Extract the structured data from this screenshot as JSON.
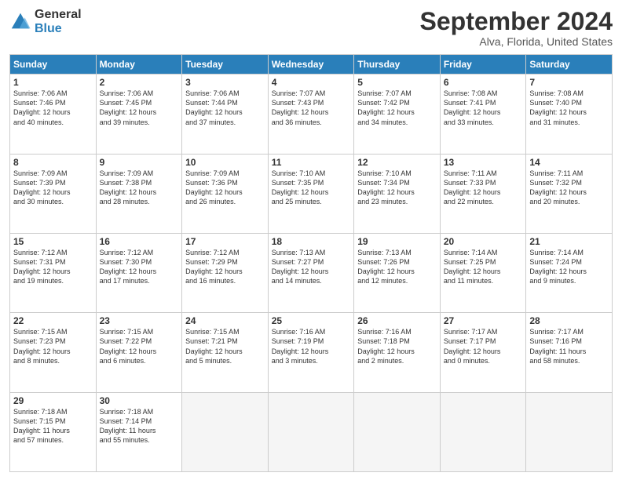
{
  "header": {
    "logo": {
      "general": "General",
      "blue": "Blue"
    },
    "title": "September 2024",
    "location": "Alva, Florida, United States"
  },
  "days_of_week": [
    "Sunday",
    "Monday",
    "Tuesday",
    "Wednesday",
    "Thursday",
    "Friday",
    "Saturday"
  ],
  "weeks": [
    [
      {
        "day": "1",
        "info": "Sunrise: 7:06 AM\nSunset: 7:46 PM\nDaylight: 12 hours\nand 40 minutes."
      },
      {
        "day": "2",
        "info": "Sunrise: 7:06 AM\nSunset: 7:45 PM\nDaylight: 12 hours\nand 39 minutes."
      },
      {
        "day": "3",
        "info": "Sunrise: 7:06 AM\nSunset: 7:44 PM\nDaylight: 12 hours\nand 37 minutes."
      },
      {
        "day": "4",
        "info": "Sunrise: 7:07 AM\nSunset: 7:43 PM\nDaylight: 12 hours\nand 36 minutes."
      },
      {
        "day": "5",
        "info": "Sunrise: 7:07 AM\nSunset: 7:42 PM\nDaylight: 12 hours\nand 34 minutes."
      },
      {
        "day": "6",
        "info": "Sunrise: 7:08 AM\nSunset: 7:41 PM\nDaylight: 12 hours\nand 33 minutes."
      },
      {
        "day": "7",
        "info": "Sunrise: 7:08 AM\nSunset: 7:40 PM\nDaylight: 12 hours\nand 31 minutes."
      }
    ],
    [
      {
        "day": "8",
        "info": "Sunrise: 7:09 AM\nSunset: 7:39 PM\nDaylight: 12 hours\nand 30 minutes."
      },
      {
        "day": "9",
        "info": "Sunrise: 7:09 AM\nSunset: 7:38 PM\nDaylight: 12 hours\nand 28 minutes."
      },
      {
        "day": "10",
        "info": "Sunrise: 7:09 AM\nSunset: 7:36 PM\nDaylight: 12 hours\nand 26 minutes."
      },
      {
        "day": "11",
        "info": "Sunrise: 7:10 AM\nSunset: 7:35 PM\nDaylight: 12 hours\nand 25 minutes."
      },
      {
        "day": "12",
        "info": "Sunrise: 7:10 AM\nSunset: 7:34 PM\nDaylight: 12 hours\nand 23 minutes."
      },
      {
        "day": "13",
        "info": "Sunrise: 7:11 AM\nSunset: 7:33 PM\nDaylight: 12 hours\nand 22 minutes."
      },
      {
        "day": "14",
        "info": "Sunrise: 7:11 AM\nSunset: 7:32 PM\nDaylight: 12 hours\nand 20 minutes."
      }
    ],
    [
      {
        "day": "15",
        "info": "Sunrise: 7:12 AM\nSunset: 7:31 PM\nDaylight: 12 hours\nand 19 minutes."
      },
      {
        "day": "16",
        "info": "Sunrise: 7:12 AM\nSunset: 7:30 PM\nDaylight: 12 hours\nand 17 minutes."
      },
      {
        "day": "17",
        "info": "Sunrise: 7:12 AM\nSunset: 7:29 PM\nDaylight: 12 hours\nand 16 minutes."
      },
      {
        "day": "18",
        "info": "Sunrise: 7:13 AM\nSunset: 7:27 PM\nDaylight: 12 hours\nand 14 minutes."
      },
      {
        "day": "19",
        "info": "Sunrise: 7:13 AM\nSunset: 7:26 PM\nDaylight: 12 hours\nand 12 minutes."
      },
      {
        "day": "20",
        "info": "Sunrise: 7:14 AM\nSunset: 7:25 PM\nDaylight: 12 hours\nand 11 minutes."
      },
      {
        "day": "21",
        "info": "Sunrise: 7:14 AM\nSunset: 7:24 PM\nDaylight: 12 hours\nand 9 minutes."
      }
    ],
    [
      {
        "day": "22",
        "info": "Sunrise: 7:15 AM\nSunset: 7:23 PM\nDaylight: 12 hours\nand 8 minutes."
      },
      {
        "day": "23",
        "info": "Sunrise: 7:15 AM\nSunset: 7:22 PM\nDaylight: 12 hours\nand 6 minutes."
      },
      {
        "day": "24",
        "info": "Sunrise: 7:15 AM\nSunset: 7:21 PM\nDaylight: 12 hours\nand 5 minutes."
      },
      {
        "day": "25",
        "info": "Sunrise: 7:16 AM\nSunset: 7:19 PM\nDaylight: 12 hours\nand 3 minutes."
      },
      {
        "day": "26",
        "info": "Sunrise: 7:16 AM\nSunset: 7:18 PM\nDaylight: 12 hours\nand 2 minutes."
      },
      {
        "day": "27",
        "info": "Sunrise: 7:17 AM\nSunset: 7:17 PM\nDaylight: 12 hours\nand 0 minutes."
      },
      {
        "day": "28",
        "info": "Sunrise: 7:17 AM\nSunset: 7:16 PM\nDaylight: 11 hours\nand 58 minutes."
      }
    ],
    [
      {
        "day": "29",
        "info": "Sunrise: 7:18 AM\nSunset: 7:15 PM\nDaylight: 11 hours\nand 57 minutes."
      },
      {
        "day": "30",
        "info": "Sunrise: 7:18 AM\nSunset: 7:14 PM\nDaylight: 11 hours\nand 55 minutes."
      },
      {
        "day": "",
        "info": ""
      },
      {
        "day": "",
        "info": ""
      },
      {
        "day": "",
        "info": ""
      },
      {
        "day": "",
        "info": ""
      },
      {
        "day": "",
        "info": ""
      }
    ]
  ]
}
